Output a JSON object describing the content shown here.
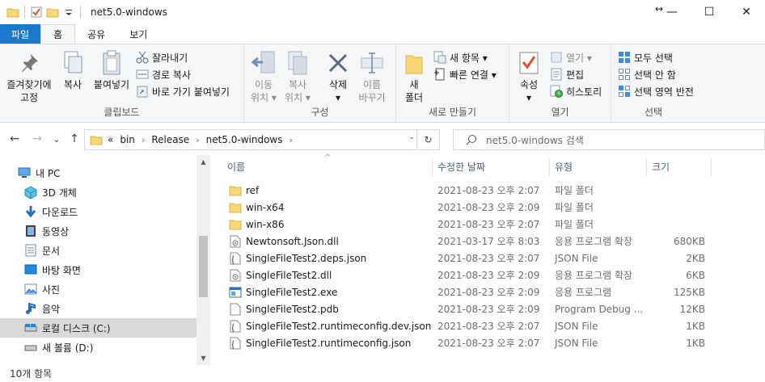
{
  "window": {
    "title": "net5.0-windows",
    "resize_glyph": "↔",
    "minimize": "—",
    "maximize": "☐",
    "close": "✕"
  },
  "tabs": [
    {
      "label": "파일"
    },
    {
      "label": "홈"
    },
    {
      "label": "공유"
    },
    {
      "label": "보기"
    }
  ],
  "ribbon": {
    "clipboard": {
      "group_label": "클립보드",
      "pin_label_1": "즐겨찾기에",
      "pin_label_2": "고정",
      "copy_label": "복사",
      "paste_label": "붙여넣기",
      "cut_label": "잘라내기",
      "copy_path_label": "경로 복사",
      "paste_shortcut_label": "바로 가기 붙여넣기"
    },
    "organize": {
      "group_label": "구성",
      "move_label_1": "이동",
      "move_label_2": "위치 ▾",
      "copy_to_label_1": "복사",
      "copy_to_label_2": "위치 ▾",
      "delete_label_1": "삭제",
      "delete_label_2": "▾",
      "rename_label_1": "이름",
      "rename_label_2": "바꾸기"
    },
    "new": {
      "group_label": "새로 만들기",
      "new_folder_label_1": "새",
      "new_folder_label_2": "폴더",
      "new_item_label": "새 항목 ▾",
      "easy_access_label": "빠른 연결 ▾"
    },
    "open": {
      "group_label": "열기",
      "properties_label": "속성",
      "properties_arrow": "▾",
      "open_label": "열기 ▾",
      "edit_label": "편집",
      "history_label": "히스토리"
    },
    "select": {
      "group_label": "선택",
      "select_all_label": "모두 선택",
      "select_none_label": "선택 안 함",
      "invert_label": "선택 영역 반전"
    }
  },
  "address": {
    "overflow": "«",
    "crumbs": [
      "bin",
      "Release",
      "net5.0-windows"
    ],
    "crumb_sep": "›",
    "search_placeholder": "net5.0-windows 검색"
  },
  "nav_glyphs": {
    "back": "←",
    "forward": "→",
    "recent": "⌄",
    "up": "↑",
    "refresh": "↻",
    "dropdown": "⌄",
    "scroll_up": "▲",
    "scroll_down": "▼"
  },
  "sidebar": {
    "items": [
      {
        "label": "내 PC"
      },
      {
        "label": "3D 개체"
      },
      {
        "label": "다운로드"
      },
      {
        "label": "동영상"
      },
      {
        "label": "문서"
      },
      {
        "label": "바탕 화면"
      },
      {
        "label": "사진"
      },
      {
        "label": "음악"
      },
      {
        "label": "로컬 디스크 (C:)"
      },
      {
        "label": "새 볼륨 (D:)"
      }
    ]
  },
  "columns": {
    "name": "이름",
    "date": "수정한 날짜",
    "type": "유형",
    "size": "크기",
    "sort_glyph": "^"
  },
  "files": [
    {
      "name": "ref",
      "date": "2021-08-23 오후 2:07",
      "type": "파일 폴더",
      "size": "",
      "icon": "folder-icon"
    },
    {
      "name": "win-x64",
      "date": "2021-08-23 오후 2:09",
      "type": "파일 폴더",
      "size": "",
      "icon": "folder-icon"
    },
    {
      "name": "win-x86",
      "date": "2021-08-23 오후 2:07",
      "type": "파일 폴더",
      "size": "",
      "icon": "folder-icon"
    },
    {
      "name": "Newtonsoft.Json.dll",
      "date": "2021-03-17 오후 8:03",
      "type": "응용 프로그램 확장",
      "size": "680KB",
      "icon": "dll-icon"
    },
    {
      "name": "SingleFileTest2.deps.json",
      "date": "2021-08-23 오후 2:07",
      "type": "JSON File",
      "size": "2KB",
      "icon": "json-file-icon"
    },
    {
      "name": "SingleFileTest2.dll",
      "date": "2021-08-23 오후 2:09",
      "type": "응용 프로그램 확장",
      "size": "6KB",
      "icon": "dll-icon"
    },
    {
      "name": "SingleFileTest2.exe",
      "date": "2021-08-23 오후 2:09",
      "type": "응용 프로그램",
      "size": "125KB",
      "icon": "exe-icon"
    },
    {
      "name": "SingleFileTest2.pdb",
      "date": "2021-08-23 오후 2:09",
      "type": "Program Debug ...",
      "size": "12KB",
      "icon": "file-icon"
    },
    {
      "name": "SingleFileTest2.runtimeconfig.dev.json",
      "date": "2021-08-23 오후 2:07",
      "type": "JSON File",
      "size": "1KB",
      "icon": "json-file-icon"
    },
    {
      "name": "SingleFileTest2.runtimeconfig.json",
      "date": "2021-08-23 오후 2:07",
      "type": "JSON File",
      "size": "1KB",
      "icon": "json-file-icon"
    }
  ],
  "status": {
    "item_count": "10개 항목"
  },
  "colors": {
    "file_tab": "#1979ca",
    "folder": "#f8d775",
    "ribbon_bg": "#f5f6f7",
    "selected": "#d9d9d9"
  }
}
